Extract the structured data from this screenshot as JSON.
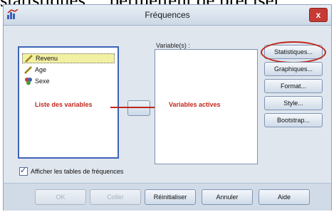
{
  "background_caption": "statistiques..., permettent de préciser",
  "window": {
    "title": "Fréquences",
    "close_glyph": "x"
  },
  "source_list": {
    "items": [
      {
        "label": "Revenu",
        "icon": "scale-icon"
      },
      {
        "label": "Age",
        "icon": "scale-icon"
      },
      {
        "label": "Sexe",
        "icon": "nominal-icon"
      }
    ]
  },
  "annotations": {
    "source_label": "Liste des variables",
    "target_label": "Variables actives",
    "color": "#c0271d"
  },
  "target_list": {
    "label": "Variable(s) :"
  },
  "side_buttons": [
    "Statistiques...",
    "Graphiques...",
    "Format...",
    "Style...",
    "Bootstrap..."
  ],
  "checkbox": {
    "label": "Afficher les tables de fréquences",
    "checked": true
  },
  "bottom_buttons": [
    "OK",
    "Coller",
    "Réinitialiser",
    "Annuler",
    "Aide"
  ]
}
